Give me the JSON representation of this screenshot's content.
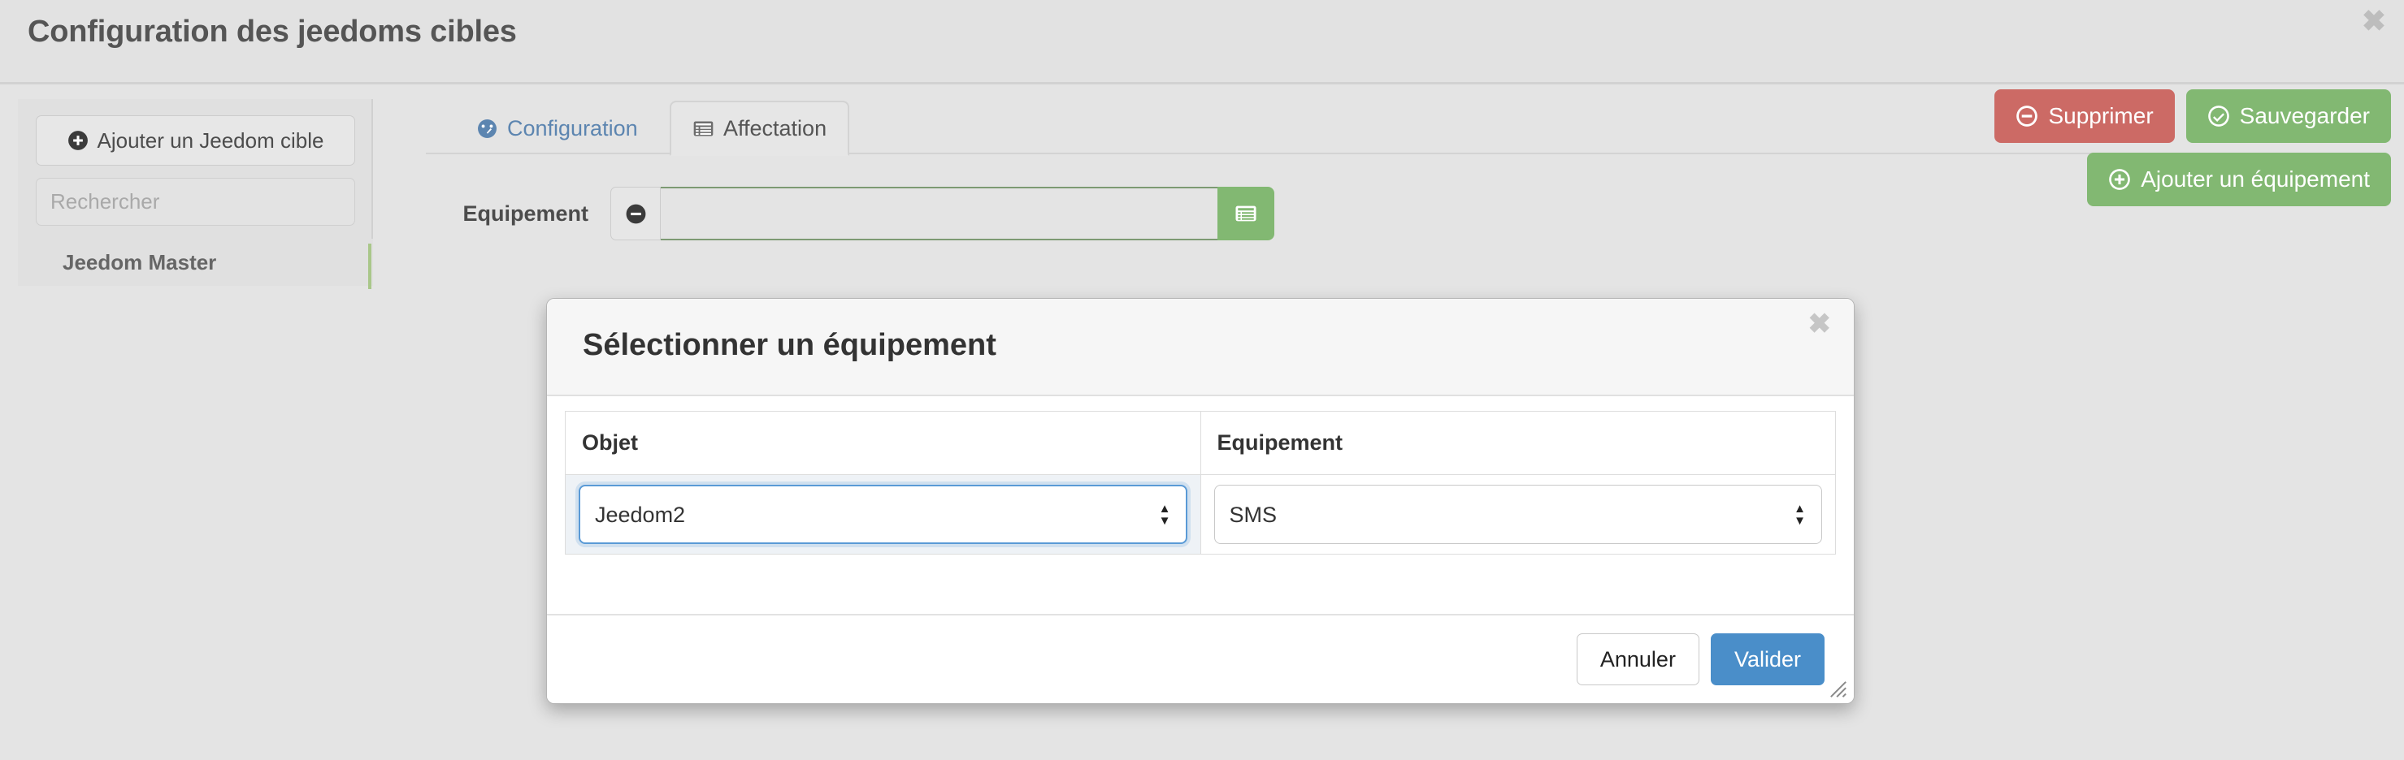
{
  "window": {
    "title": "Configuration des jeedoms cibles",
    "close_label": "✖"
  },
  "sidebar": {
    "add_button": {
      "label": "Ajouter un Jeedom cible",
      "icon": "plus-circle-icon"
    },
    "search": {
      "value": "",
      "placeholder": "Rechercher"
    },
    "items": [
      {
        "label": "Jeedom Master",
        "selected": true,
        "accent_color": "#a9c78a"
      }
    ]
  },
  "main": {
    "tabs": [
      {
        "label": "Configuration",
        "icon": "dashboard-icon",
        "active": false,
        "color": "#5c85b0"
      },
      {
        "label": "Affectation",
        "icon": "list-alt-icon",
        "active": true,
        "color": "#555555"
      }
    ],
    "actions": [
      {
        "label": "Supprimer",
        "icon": "minus-circle-icon",
        "color": "#cc6a65"
      },
      {
        "label": "Sauvegarder",
        "icon": "check-circle-icon",
        "color": "#82b872"
      }
    ],
    "secondary_action": {
      "label": "Ajouter un équipement",
      "icon": "plus-circle-icon",
      "color": "#82b872"
    },
    "equipement_row": {
      "label": "Equipement",
      "remove_icon": "minus-circle-icon",
      "input_value": "",
      "input_placeholder": "",
      "picker_icon": "list-alt-icon",
      "border_color": "#7d9a73"
    }
  },
  "modal": {
    "title": "Sélectionner un équipement",
    "close_label": "✖",
    "table": {
      "headers": [
        "Objet",
        "Equipement"
      ],
      "rows": [
        {
          "objet": {
            "value": "Jeedom2",
            "focused": true
          },
          "equipement": {
            "value": "SMS",
            "focused": false
          }
        }
      ]
    },
    "footer": {
      "cancel_label": "Annuler",
      "validate_label": "Valider",
      "validate_color": "#4a8ec9"
    },
    "resize_grip": "resize-grip-icon"
  }
}
